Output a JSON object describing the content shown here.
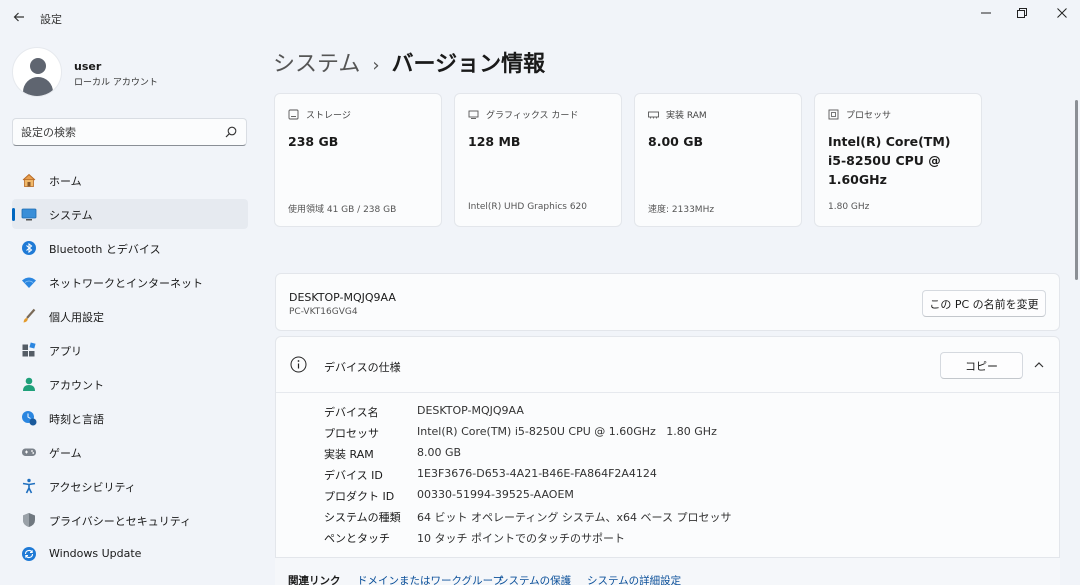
{
  "window": {
    "title": "設定"
  },
  "user": {
    "name": "user",
    "account_type": "ローカル アカウント"
  },
  "search": {
    "placeholder": "設定の検索"
  },
  "sidebar": {
    "items": [
      {
        "label": "ホーム",
        "icon": "home-icon"
      },
      {
        "label": "システム",
        "icon": "system-icon",
        "active": true
      },
      {
        "label": "Bluetooth とデバイス",
        "icon": "bluetooth-icon"
      },
      {
        "label": "ネットワークとインターネット",
        "icon": "network-icon"
      },
      {
        "label": "個人用設定",
        "icon": "brush-icon"
      },
      {
        "label": "アプリ",
        "icon": "apps-icon"
      },
      {
        "label": "アカウント",
        "icon": "account-icon"
      },
      {
        "label": "時刻と言語",
        "icon": "time-language-icon"
      },
      {
        "label": "ゲーム",
        "icon": "gamepad-icon"
      },
      {
        "label": "アクセシビリティ",
        "icon": "accessibility-icon"
      },
      {
        "label": "プライバシーとセキュリティ",
        "icon": "shield-icon"
      },
      {
        "label": "Windows Update",
        "icon": "update-icon"
      }
    ]
  },
  "breadcrumb": {
    "parent": "システム",
    "separator": "›",
    "current": "バージョン情報"
  },
  "cards": [
    {
      "label": "ストレージ",
      "value": "238 GB",
      "detail": "使用領域 41 GB / 238 GB",
      "icon": "storage-icon"
    },
    {
      "label": "グラフィックス カード",
      "value": "128 MB",
      "detail": "Intel(R) UHD Graphics 620",
      "icon": "graphics-card-icon"
    },
    {
      "label": "実装 RAM",
      "value": "8.00 GB",
      "detail": "速度: 2133MHz",
      "icon": "ram-icon"
    },
    {
      "label": "プロセッサ",
      "value": "Intel(R) Core(TM) i5-8250U CPU @ 1.60GHz",
      "detail": "1.80 GHz",
      "icon": "processor-icon"
    }
  ],
  "pc": {
    "name": "DESKTOP-MQJQ9AA",
    "model": "PC-VKT16GVG4",
    "rename_label": "この PC の名前を変更"
  },
  "device_spec": {
    "title": "デバイスの仕様",
    "copy_label": "コピー",
    "rows": [
      {
        "key": "デバイス名",
        "value": "DESKTOP-MQJQ9AA"
      },
      {
        "key": "プロセッサ",
        "value": "Intel(R) Core(TM) i5-8250U CPU @ 1.60GHz   1.80 GHz"
      },
      {
        "key": "実装 RAM",
        "value": "8.00 GB"
      },
      {
        "key": "デバイス ID",
        "value": "1E3F3676-D653-4A21-B46E-FA864F2A4124"
      },
      {
        "key": "プロダクト ID",
        "value": "00330-51994-39525-AAOEM"
      },
      {
        "key": "システムの種類",
        "value": "64 ビット オペレーティング システム、x64 ベース プロセッサ"
      },
      {
        "key": "ペンとタッチ",
        "value": "10 タッチ ポイントでのタッチのサポート"
      }
    ]
  },
  "related_links": {
    "title": "関連リンク",
    "links": [
      "ドメインまたはワークグループ",
      "システムの保護",
      "システムの詳細設定"
    ]
  },
  "colors": {
    "accent": "#0067c0",
    "background": "#f1f4f9",
    "card": "#fbfcfd"
  }
}
